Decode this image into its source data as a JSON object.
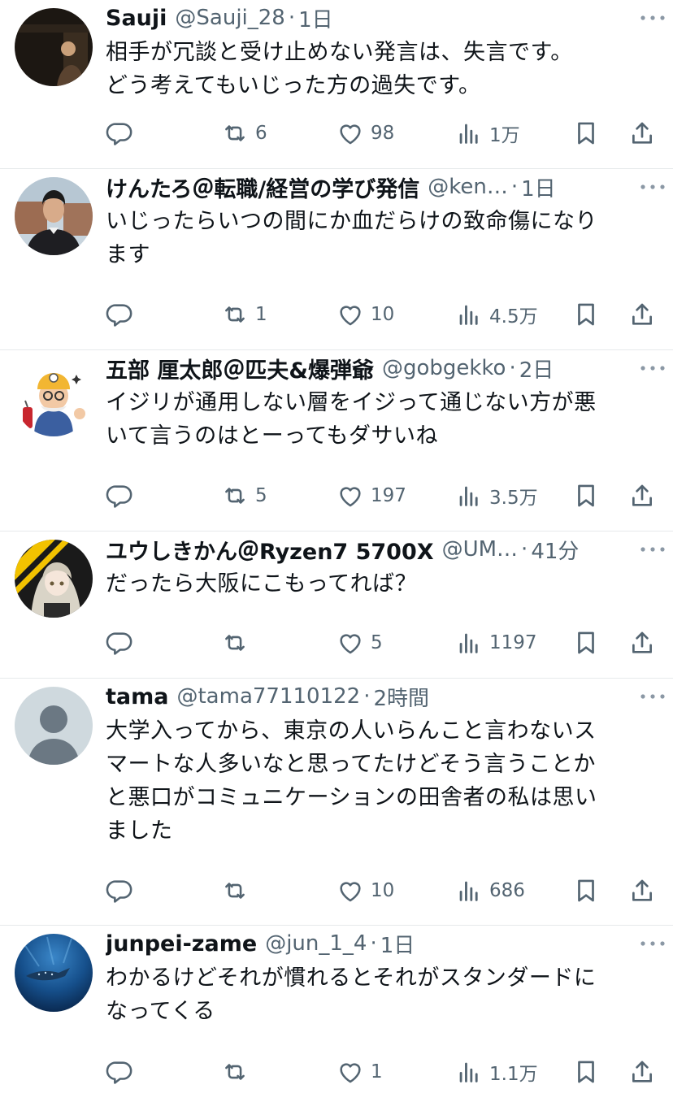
{
  "colors": {
    "text": "#0f1419",
    "muted": "#536471",
    "divider": "#e6e9eb"
  },
  "tweets": [
    {
      "name": "Sauji",
      "handle": "@Sauji_28",
      "sep": "·",
      "time": "1日",
      "lines": [
        "相手が冗談と受け止めない発言は、失言です。",
        "どう考えてもいじった方の過失です。"
      ],
      "replies": "",
      "retweets": "6",
      "likes": "98",
      "views": "1万",
      "avatar": "dark-photo-avatar"
    },
    {
      "name": "けんたろ＠転職/経営の学び発信",
      "handle": "@ken…",
      "sep": "·",
      "time": "1日",
      "lines": [
        "いじったらいつの間にか血だらけの致命傷になり",
        "ます"
      ],
      "replies": "",
      "retweets": "1",
      "likes": "10",
      "views": "4.5万",
      "avatar": "man-portrait-avatar"
    },
    {
      "name": "五部 厘太郎＠匹夫&爆弾爺",
      "handle": "@gobgekko",
      "sep": "·",
      "time": "2日",
      "lines": [
        "イジリが通用しない層をイジって通じない方が悪",
        "いて言うのはとーってもダサいね"
      ],
      "replies": "",
      "retweets": "5",
      "likes": "197",
      "views": "3.5万",
      "avatar": "miner-cartoon-avatar"
    },
    {
      "name": "ユウしきかん＠Ryzen7 5700X",
      "handle": "@UM…",
      "sep": "·",
      "time": "41分",
      "lines": [
        "だったら大阪にこもってれば？"
      ],
      "replies": "",
      "retweets": "",
      "likes": "5",
      "views": "1197",
      "avatar": "anime-girl-avatar"
    },
    {
      "name": "tama",
      "handle": "@tama77110122",
      "sep": "·",
      "time": "2時間",
      "lines": [
        "大学入ってから、東京の人いらんこと言わないス",
        "マートな人多いなと思ってたけどそう言うことか",
        "と悪口がコミュニケーションの田舎者の私は思い",
        "ました"
      ],
      "replies": "",
      "retweets": "",
      "likes": "10",
      "views": "686",
      "avatar": "default-user-avatar"
    },
    {
      "name": "junpei-zame",
      "handle": "@jun_1_4",
      "sep": "·",
      "time": "1日",
      "lines": [
        "わかるけどそれが慣れるとそれがスタンダードに",
        "なってくる"
      ],
      "replies": "",
      "retweets": "",
      "likes": "1",
      "views": "1.1万",
      "avatar": "underwater-avatar"
    }
  ]
}
